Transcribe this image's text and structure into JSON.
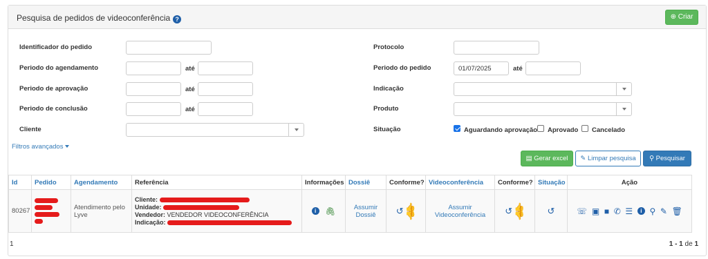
{
  "header": {
    "title": "Pesquisa de pedidos de videoconferência",
    "help_icon": "?",
    "create_label": "Criar",
    "create_icon": "plus-circle-icon"
  },
  "form": {
    "identificador_label": "Identificador do pedido",
    "identificador_value": "",
    "periodo_agendamento_label": "Periodo do agendamento",
    "periodo_aprovacao_label": "Periodo de aprovação",
    "periodo_conclusao_label": "Periodo de conclusão",
    "ate": "até",
    "cliente_label": "Cliente",
    "protocolo_label": "Protocolo",
    "periodo_pedido_label": "Periodo do pedido",
    "periodo_pedido_from": "01/07/2025",
    "indicacao_label": "Indicação",
    "produto_label": "Produto",
    "situacao_label": "Situação",
    "situacao_options": [
      {
        "label": "Aguardando aprovação",
        "checked": true
      },
      {
        "label": "Aprovado",
        "checked": false
      },
      {
        "label": "Cancelado",
        "checked": false
      }
    ],
    "advanced_filters": "Filtros avançados"
  },
  "actions": {
    "excel": "Gerar excel",
    "clear": "Limpar pesquisa",
    "search": "Pesquisar"
  },
  "table": {
    "headers": [
      "Id",
      "Pedido",
      "Agendamento",
      "Referência",
      "Informações",
      "Dossiê",
      "Conforme?",
      "Videoconferência",
      "Conforme?",
      "Situação",
      "Ação"
    ],
    "rows": [
      {
        "id": "80267",
        "agendamento": "Atendimento pelo Lyve",
        "ref_cliente_label": "Cliente:",
        "ref_unidade_label": "Unidade:",
        "ref_vendedor_label": "Vendedor:",
        "ref_vendedor_value": "VENDEDOR VIDEOCONFERÊNCIA",
        "ref_indicacao_label": "Indicação:",
        "dossie_link": "Assumir Dossiê",
        "video_link": "Assumir Videoconferência"
      }
    ]
  },
  "footer": {
    "page": "1",
    "range": "1 - 1",
    "of": "de",
    "total": "1"
  },
  "colors": {
    "primary": "#337ab7",
    "success": "#5cb85c",
    "redaction": "#e51b1b"
  }
}
